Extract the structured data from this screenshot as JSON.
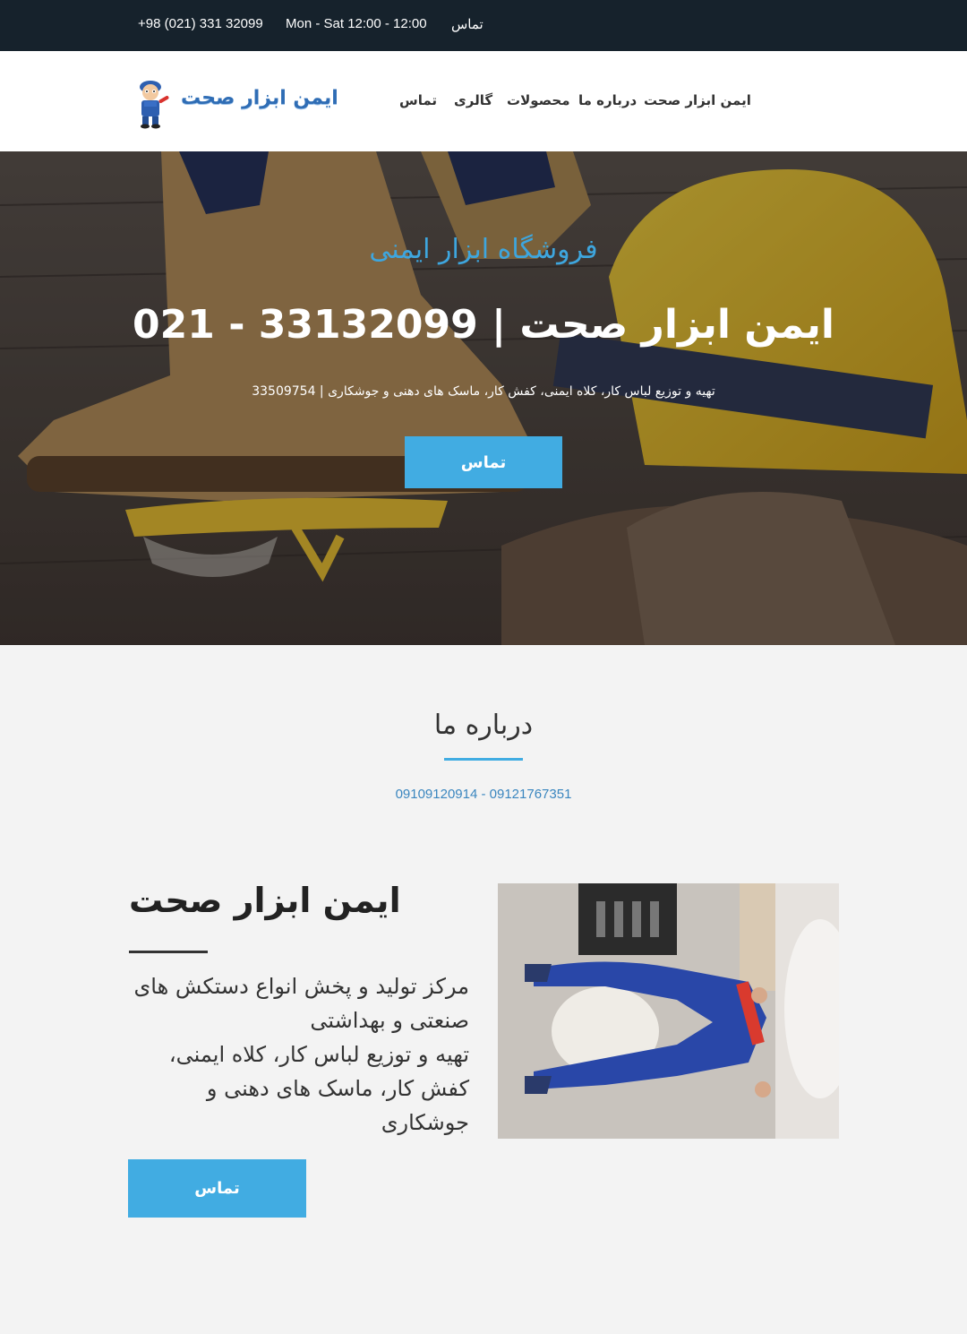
{
  "topbar": {
    "phone": "+98 (021) 331 32099",
    "hours": "Mon - Sat 12:00 - 12:00",
    "contact": "تماس"
  },
  "header": {
    "logo_text": "ایمن ابزار صحت",
    "nav": [
      "ایمن ابزار صحت",
      "درباره ما",
      "محصولات",
      "گالری",
      "تماس"
    ]
  },
  "hero": {
    "subtitle": "فروشگاه ابزار ایمنی",
    "title": "ایمن ابزار صحت | 33132099 - 021",
    "description": "تهیه و توزیع لباس کار، کلاه ایمنی، کفش کار، ماسک های دهنی و جوشکاری | 33509754",
    "button": "تماس"
  },
  "about": {
    "title": "درباره ما",
    "phones": "09109120914 - 09121767351"
  },
  "feature": {
    "title": "ایمن ابزار صحت",
    "line1": "مرکز تولید و پخش انواع دستکش های صنعتی و بهداشتی",
    "line2": "تهیه و توزیع لباس کار، کلاه ایمنی، کفش کار، ماسک های دهنی و جوشکاری",
    "button": "تماس"
  }
}
